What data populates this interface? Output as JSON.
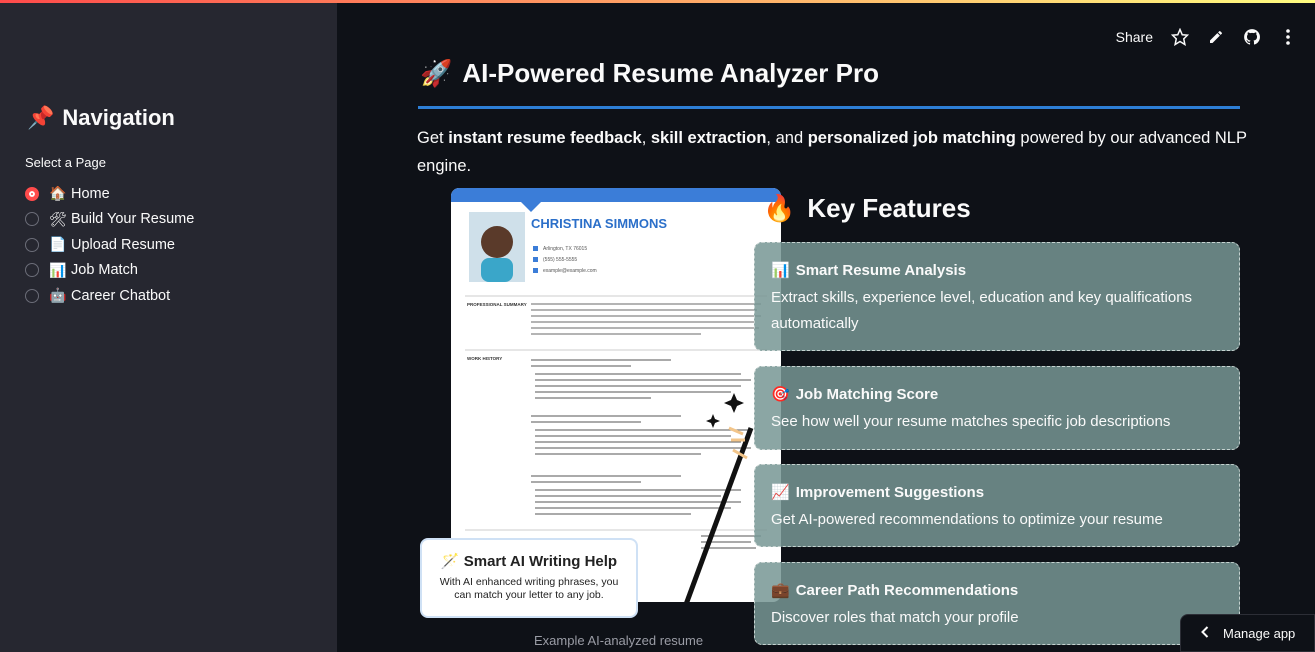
{
  "sidebar": {
    "nav_icon": "📌",
    "nav_title": "Navigation",
    "select_label": "Select a Page",
    "pages": [
      {
        "emoji": "🏠",
        "label": "Home",
        "selected": true
      },
      {
        "emoji": "🛠",
        "label": "Build Your Resume",
        "selected": false
      },
      {
        "emoji": "📄",
        "label": "Upload Resume",
        "selected": false
      },
      {
        "emoji": "📊",
        "label": "Job Match",
        "selected": false
      },
      {
        "emoji": "🤖",
        "label": "Career Chatbot",
        "selected": false
      }
    ]
  },
  "toolbar": {
    "share_label": "Share",
    "icons": [
      "star-icon",
      "pencil-icon",
      "github-icon",
      "more-vertical-icon"
    ]
  },
  "main": {
    "title_icon": "🚀",
    "title": "AI-Powered Resume Analyzer Pro",
    "intro": {
      "p1": "Get ",
      "b1": "instant resume feedback",
      "p2": ", ",
      "b2": "skill extraction",
      "p3": ", and ",
      "b3": "personalized job matching",
      "p4": " powered by our advanced NLP engine."
    },
    "caption": "Example AI-analyzed resume"
  },
  "resume_image": {
    "name": "CHRISTINA SIMMONS",
    "location": "Arlington, TX 76015",
    "phone": "(555) 555-5555",
    "email": "example@example.com",
    "section_summary": "PROFESSIONAL SUMMARY",
    "section_work": "WORK HISTORY",
    "writing_help_title": "Smart AI Writing Help",
    "writing_help_desc": "With AI enhanced writing phrases, you can match your letter to any job."
  },
  "features": {
    "title_icon": "🔥",
    "title": "Key Features",
    "cards": [
      {
        "icon": "📊",
        "title": "Smart Resume Analysis",
        "desc": "Extract skills, experience level, education and key qualifications automatically"
      },
      {
        "icon": "🎯",
        "title": "Job Matching Score",
        "desc": "See how well your resume matches specific job descriptions"
      },
      {
        "icon": "📈",
        "title": "Improvement Suggestions",
        "desc": "Get AI-powered recommendations to optimize your resume"
      },
      {
        "icon": "💼",
        "title": "Career Path Recommendations",
        "desc": "Discover roles that match your profile"
      }
    ]
  },
  "manage_app": {
    "label": "Manage app"
  },
  "colors": {
    "accent": "#ff4b4b",
    "rule": "#2d7fd6",
    "card_bg": "#779694",
    "sidebar_bg": "#262730",
    "main_bg": "#0e1117"
  }
}
